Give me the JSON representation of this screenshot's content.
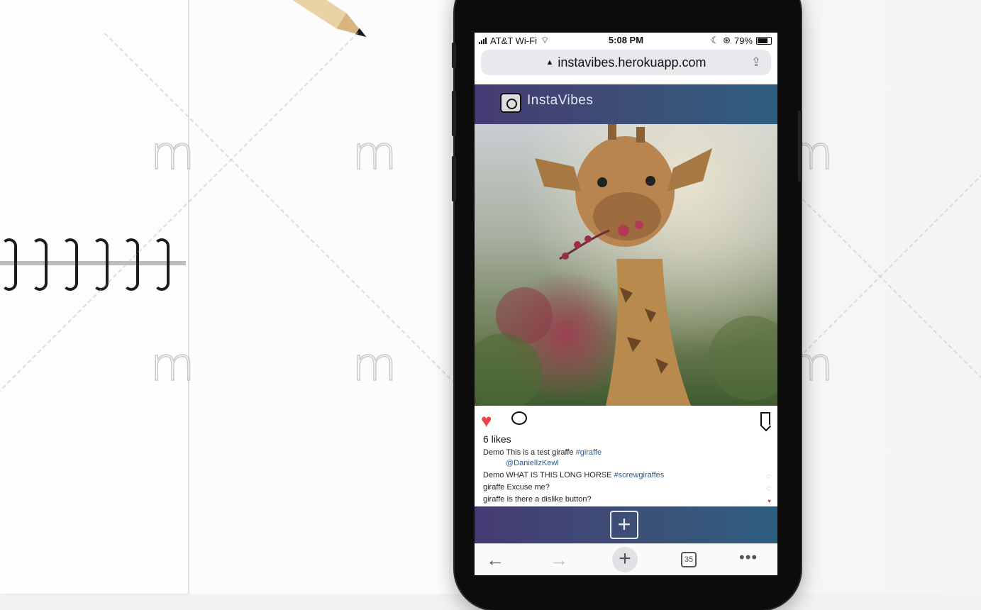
{
  "watermark": {
    "glyph": "m"
  },
  "status_bar": {
    "carrier": "AT&T Wi-Fi",
    "time": "5:08 PM",
    "battery": "79%"
  },
  "browser": {
    "url": "instavibes.herokuapp.com",
    "open_tabs": "35"
  },
  "app": {
    "title": "InstaVibes",
    "brand_colors": {
      "header_start": "#453b74",
      "header_end": "#2e5e80",
      "like": "#e9434f"
    }
  },
  "post": {
    "likes": "6 likes",
    "liked": true,
    "comments": [
      {
        "user": "Demo",
        "text": "This is a test giraffe",
        "tag": "#giraffe",
        "mention": "@DanielIzKewl"
      },
      {
        "user": "Demo",
        "text": "WHAT IS THIS LONG HORSE",
        "tag": "#screwgiraffes"
      },
      {
        "user": "giraffe",
        "text": "Excuse me?"
      },
      {
        "user": "giraffe",
        "text": "Is there a dislike button?"
      }
    ]
  },
  "icons": {
    "like": "heart-icon",
    "comment": "comment-icon",
    "bookmark": "bookmark-icon",
    "add": "plus-icon",
    "back": "arrow-left-icon",
    "forward": "arrow-right-icon",
    "tabs": "tabs-icon",
    "more": "more-icon"
  }
}
